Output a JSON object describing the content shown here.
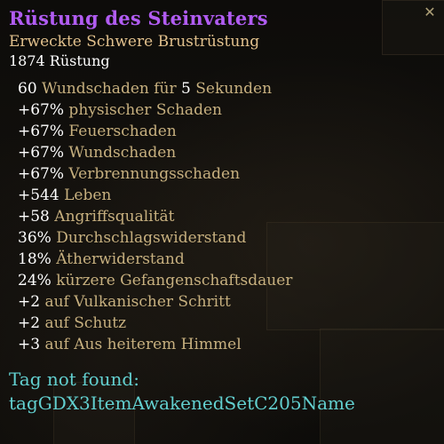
{
  "item": {
    "name": "Rüstung des Steinvaters",
    "type": "Erweckte Schwere Brustrüstung",
    "armor": "1874 Rüstung"
  },
  "stats": [
    {
      "value": "60",
      "text": " Wundschaden für ",
      "value2": "5",
      "text2": " Sekunden"
    },
    {
      "value": "+67%",
      "text": " physischer Schaden"
    },
    {
      "value": "+67%",
      "text": " Feuerschaden"
    },
    {
      "value": "+67%",
      "text": " Wundschaden"
    },
    {
      "value": "+67%",
      "text": " Verbrennungsschaden"
    },
    {
      "value": "+544",
      "text": " Leben"
    },
    {
      "value": "+58",
      "text": " Angriffsqualität"
    },
    {
      "value": "36%",
      "text": " Durchschlagswiderstand"
    },
    {
      "value": "18%",
      "text": " Ätherwiderstand"
    },
    {
      "value": "24%",
      "text": " kürzere Gefangenschaftsdauer"
    },
    {
      "value": "+2",
      "text": " auf Vulkanischer Schritt"
    },
    {
      "value": "+2",
      "text": " auf Schutz"
    },
    {
      "value": "+3",
      "text": " auf Aus heiterem Himmel"
    }
  ],
  "missing_tag": {
    "line1": "Tag not found:",
    "line2": "tagGDX3ItemAwakenedSetC205Name"
  },
  "controls": {
    "close_glyph": "✕"
  },
  "colors": {
    "item_name": "#b15cf2",
    "item_type": "#e2c18d",
    "value": "#ffffff",
    "stat_text": "#c7b07f",
    "missing_tag": "#62cfcf"
  }
}
